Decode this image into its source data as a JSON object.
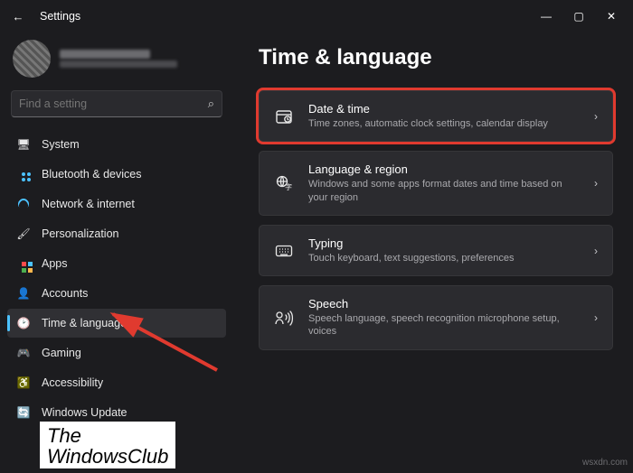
{
  "title": "Settings",
  "window_controls": {
    "min": "—",
    "max": "▢",
    "close": "✕"
  },
  "search": {
    "placeholder": "Find a setting"
  },
  "sidebar": {
    "items": [
      {
        "label": "System"
      },
      {
        "label": "Bluetooth & devices"
      },
      {
        "label": "Network & internet"
      },
      {
        "label": "Personalization"
      },
      {
        "label": "Apps"
      },
      {
        "label": "Accounts"
      },
      {
        "label": "Time & language"
      },
      {
        "label": "Gaming"
      },
      {
        "label": "Accessibility"
      },
      {
        "label": "Windows Update"
      }
    ]
  },
  "page": {
    "heading": "Time & language",
    "cards": [
      {
        "title": "Date & time",
        "sub": "Time zones, automatic clock settings, calendar display"
      },
      {
        "title": "Language & region",
        "sub": "Windows and some apps format dates and time based on your region"
      },
      {
        "title": "Typing",
        "sub": "Touch keyboard, text suggestions, preferences"
      },
      {
        "title": "Speech",
        "sub": "Speech language, speech recognition microphone setup, voices"
      }
    ]
  },
  "watermark": {
    "l1": "The",
    "l2": "WindowsClub"
  },
  "wsxdn": "wsxdn.com"
}
